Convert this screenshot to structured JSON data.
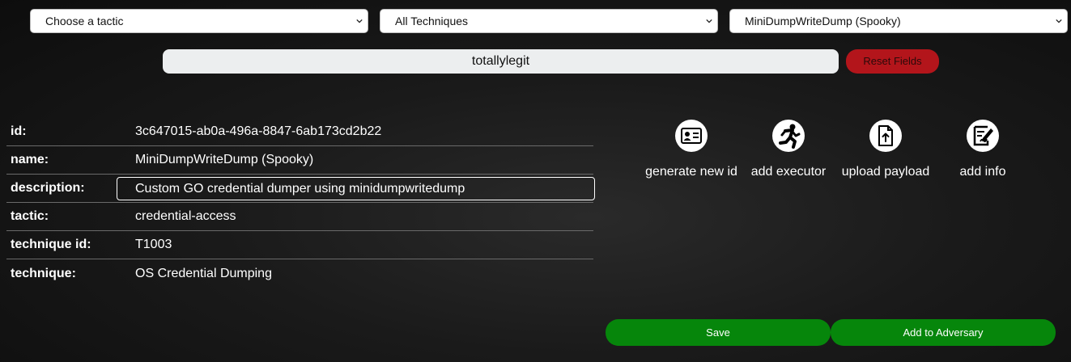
{
  "selects": {
    "tactic": "Choose a tactic",
    "technique": "All Techniques",
    "ability": "MiniDumpWriteDump (Spooky)"
  },
  "search": {
    "value": "totallylegit"
  },
  "reset_label": "Reset Fields",
  "fields": [
    {
      "label": "id:",
      "value": "3c647015-ab0a-496a-8847-6ab173cd2b22"
    },
    {
      "label": "name:",
      "value": "MiniDumpWriteDump (Spooky)"
    },
    {
      "label": "description:",
      "value": "Custom GO credential dumper using minidumpwritedump"
    },
    {
      "label": "tactic:",
      "value": "credential-access"
    },
    {
      "label": "technique id:",
      "value": "T1003"
    },
    {
      "label": "technique:",
      "value": "OS Credential Dumping"
    }
  ],
  "actions": [
    {
      "label": "generate new id",
      "icon": "id-card-icon"
    },
    {
      "label": "add executor",
      "icon": "running-person-icon"
    },
    {
      "label": "upload payload",
      "icon": "file-upload-icon"
    },
    {
      "label": "add info",
      "icon": "edit-document-icon"
    }
  ],
  "buttons": {
    "save": "Save",
    "add_to_adversary": "Add to Adversary"
  },
  "colors": {
    "reset": "#b3151b",
    "primary": "#06860b",
    "background": "#1a1a1a"
  }
}
